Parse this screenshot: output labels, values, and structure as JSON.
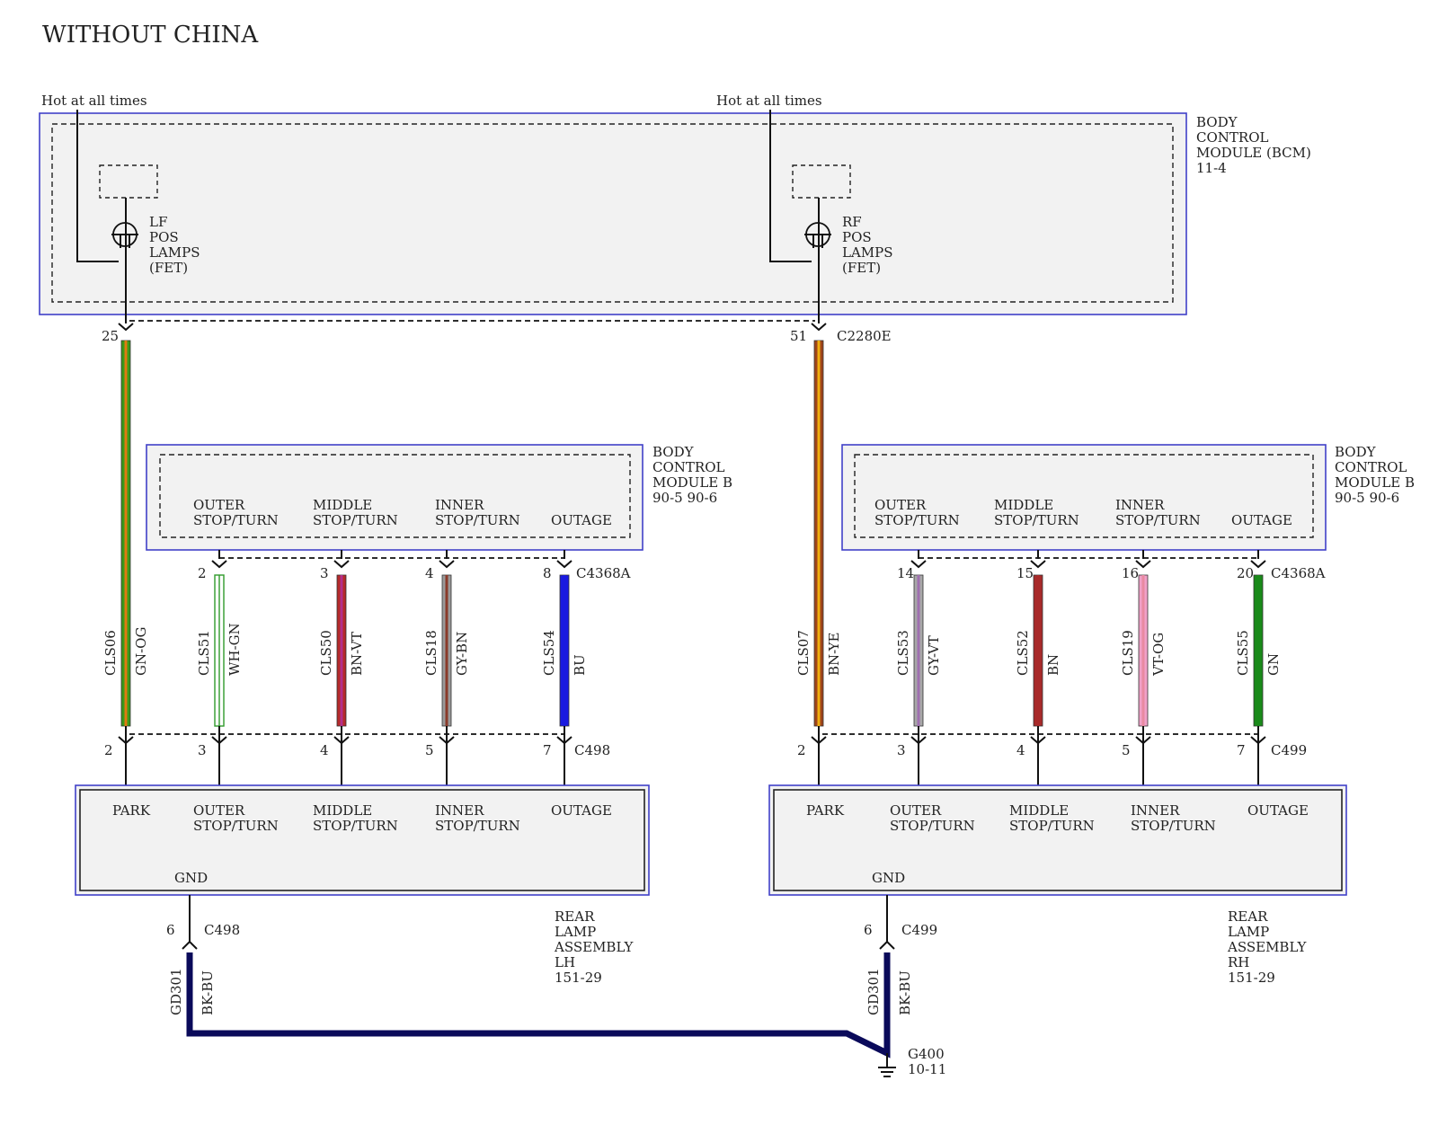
{
  "title": "WITHOUT CHINA",
  "hot_left": "Hot at all times",
  "hot_right": "Hot at all times",
  "bcm": {
    "lines": [
      "BODY",
      "CONTROL",
      "MODULE (BCM)",
      "11-4"
    ]
  },
  "fet_left": {
    "lines": [
      "LF",
      "POS",
      "LAMPS",
      "(FET)"
    ]
  },
  "fet_right": {
    "lines": [
      "RF",
      "POS",
      "LAMPS",
      "(FET)"
    ]
  },
  "bcm_connector": "C2280E",
  "bcm_pin_left": "25",
  "bcm_pin_right": "51",
  "bcmb": {
    "lines": [
      "BODY",
      "CONTROL",
      "MODULE B",
      "90-5    90-6"
    ]
  },
  "bcmb_connector": "C4368A",
  "bcmb_labels": [
    [
      "OUTER",
      "STOP/TURN"
    ],
    [
      "MIDDLE",
      "STOP/TURN"
    ],
    [
      "INNER",
      "STOP/TURN"
    ],
    [
      "",
      "OUTAGE"
    ]
  ],
  "lamp_labels": [
    [
      "PARK",
      ""
    ],
    [
      "OUTER",
      "STOP/TURN"
    ],
    [
      "MIDDLE",
      "STOP/TURN"
    ],
    [
      "INNER",
      "STOP/TURN"
    ],
    [
      "OUTAGE",
      ""
    ]
  ],
  "gnd_label": "GND",
  "lh": {
    "connector": "C498",
    "assembly": [
      "REAR",
      "LAMP",
      "ASSEMBLY",
      "LH",
      "151-29"
    ],
    "gnd_pin": "6",
    "wires": [
      {
        "circuit": "CLS06",
        "color": "GN-OG",
        "top_pin": "25",
        "bottom_pin": "2",
        "c1": "#3a9a1a",
        "c2": "#e07a10",
        "style": "solid"
      },
      {
        "circuit": "CLS51",
        "color": "WH-GN",
        "top_pin": "2",
        "bottom_pin": "3",
        "c1": "#ffffff",
        "c2": "#2f9a2a",
        "style": "hollow"
      },
      {
        "circuit": "CLS50",
        "color": "BN-VT",
        "top_pin": "3",
        "bottom_pin": "4",
        "c1": "#b52a2a",
        "c2": "#b2308c",
        "style": "solid"
      },
      {
        "circuit": "CLS18",
        "color": "GY-BN",
        "top_pin": "4",
        "bottom_pin": "5",
        "c1": "#9a9a9a",
        "c2": "#8a3a2a",
        "style": "solid"
      },
      {
        "circuit": "CLS54",
        "color": "BU",
        "top_pin": "8",
        "bottom_pin": "7",
        "c1": "#1a1ae0",
        "c2": "#1a1ae0",
        "style": "solid"
      }
    ]
  },
  "rh": {
    "connector": "C499",
    "assembly": [
      "REAR",
      "LAMP",
      "ASSEMBLY",
      "RH",
      "151-29"
    ],
    "gnd_pin": "6",
    "wires": [
      {
        "circuit": "CLS07",
        "color": "BN-YE",
        "top_pin": "51",
        "bottom_pin": "2",
        "c1": "#a0451a",
        "c2": "#f0b010",
        "style": "solid"
      },
      {
        "circuit": "CLS53",
        "color": "GY-VT",
        "top_pin": "14",
        "bottom_pin": "3",
        "c1": "#a8a8a8",
        "c2": "#a070b0",
        "style": "solid"
      },
      {
        "circuit": "CLS52",
        "color": "BN",
        "top_pin": "15",
        "bottom_pin": "4",
        "c1": "#a82a2a",
        "c2": "#a82a2a",
        "style": "solid"
      },
      {
        "circuit": "CLS19",
        "color": "VT-OG",
        "top_pin": "16",
        "bottom_pin": "5",
        "c1": "#f0a0c8",
        "c2": "#e88aa0",
        "style": "solid"
      },
      {
        "circuit": "CLS55",
        "color": "GN",
        "top_pin": "20",
        "bottom_pin": "7",
        "c1": "#1a8a1a",
        "c2": "#1a8a1a",
        "style": "solid"
      }
    ]
  },
  "ground": {
    "circuit": "GD301",
    "color": "BK-BU",
    "wire_color": "#0a0a5a",
    "point": "G400",
    "point_ref": "10-11"
  }
}
